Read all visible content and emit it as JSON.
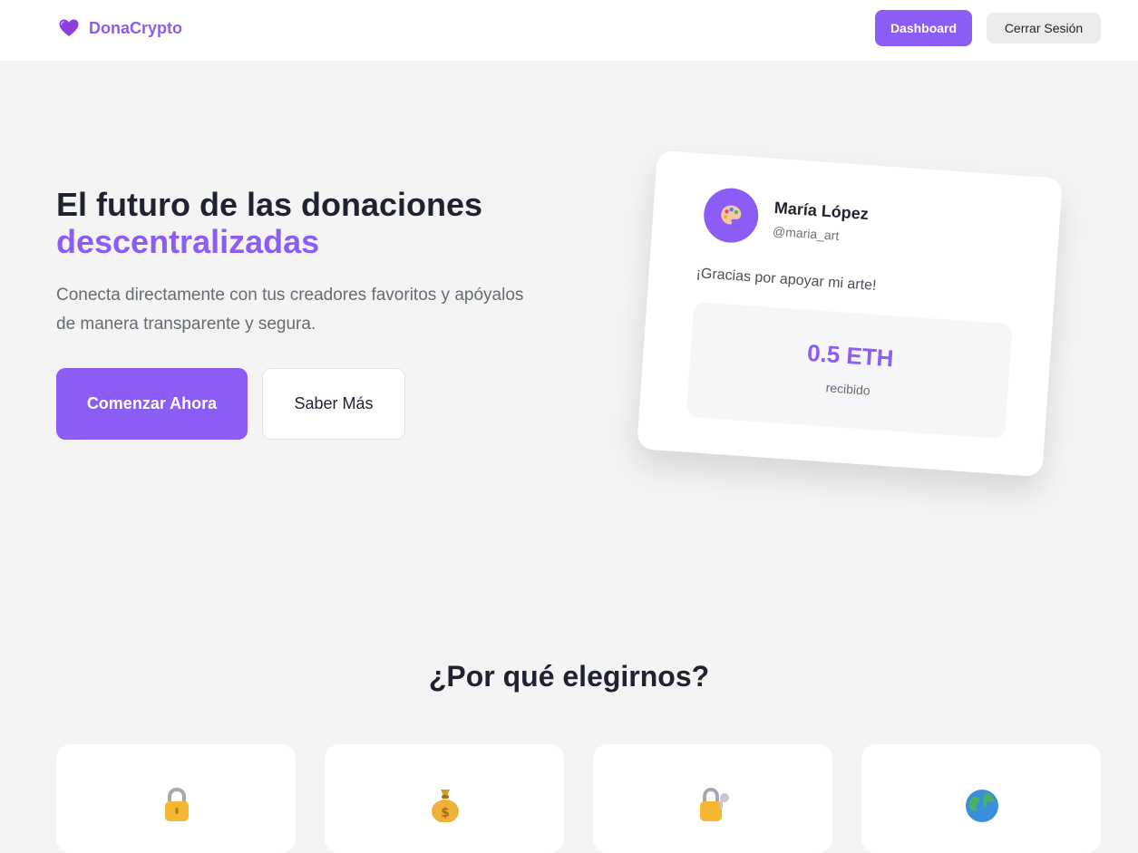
{
  "header": {
    "brand": "DonaCrypto",
    "logo_icon": "purple-heart-icon",
    "dashboard_label": "Dashboard",
    "logout_label": "Cerrar Sesión"
  },
  "hero": {
    "title_line1": "El futuro de las donaciones",
    "title_line2": "descentralizadas",
    "subtitle": "Conecta directamente con tus creadores favoritos y apóyalos de manera transparente y segura.",
    "primary_button": "Comenzar Ahora",
    "secondary_button": "Saber Más"
  },
  "donation_card": {
    "avatar_icon": "palette-icon",
    "name": "María López",
    "handle": "@maria_art",
    "message": "¡Gracias por apoyar mi arte!",
    "amount": "0.5 ETH",
    "amount_label": "recibido"
  },
  "features": {
    "title": "¿Por qué elegirnos?",
    "items": [
      {
        "icon": "lock-icon"
      },
      {
        "icon": "money-bag-icon"
      },
      {
        "icon": "lock-with-key-icon"
      },
      {
        "icon": "globe-icon"
      }
    ]
  },
  "colors": {
    "accent": "#8b5cf6",
    "background": "#f4f4f4",
    "text_dark": "#1f2230",
    "text_muted": "#666b78"
  }
}
